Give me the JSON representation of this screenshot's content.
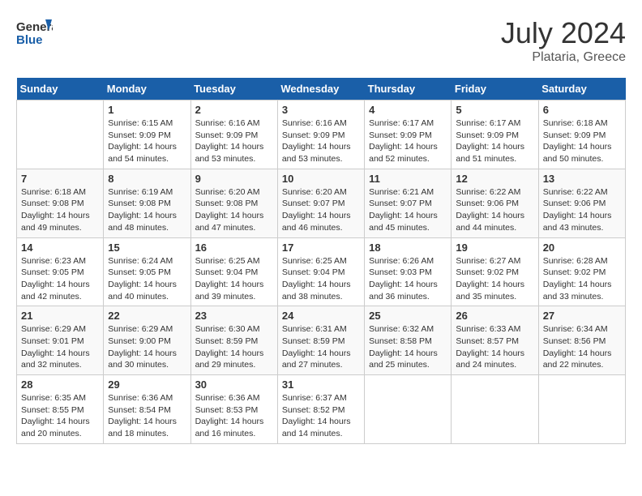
{
  "header": {
    "logo_general": "General",
    "logo_blue": "Blue",
    "month": "July 2024",
    "location": "Plataria, Greece"
  },
  "weekdays": [
    "Sunday",
    "Monday",
    "Tuesday",
    "Wednesday",
    "Thursday",
    "Friday",
    "Saturday"
  ],
  "weeks": [
    [
      {
        "day": "",
        "info": ""
      },
      {
        "day": "1",
        "info": "Sunrise: 6:15 AM\nSunset: 9:09 PM\nDaylight: 14 hours\nand 54 minutes."
      },
      {
        "day": "2",
        "info": "Sunrise: 6:16 AM\nSunset: 9:09 PM\nDaylight: 14 hours\nand 53 minutes."
      },
      {
        "day": "3",
        "info": "Sunrise: 6:16 AM\nSunset: 9:09 PM\nDaylight: 14 hours\nand 53 minutes."
      },
      {
        "day": "4",
        "info": "Sunrise: 6:17 AM\nSunset: 9:09 PM\nDaylight: 14 hours\nand 52 minutes."
      },
      {
        "day": "5",
        "info": "Sunrise: 6:17 AM\nSunset: 9:09 PM\nDaylight: 14 hours\nand 51 minutes."
      },
      {
        "day": "6",
        "info": "Sunrise: 6:18 AM\nSunset: 9:09 PM\nDaylight: 14 hours\nand 50 minutes."
      }
    ],
    [
      {
        "day": "7",
        "info": "Sunrise: 6:18 AM\nSunset: 9:08 PM\nDaylight: 14 hours\nand 49 minutes."
      },
      {
        "day": "8",
        "info": "Sunrise: 6:19 AM\nSunset: 9:08 PM\nDaylight: 14 hours\nand 48 minutes."
      },
      {
        "day": "9",
        "info": "Sunrise: 6:20 AM\nSunset: 9:08 PM\nDaylight: 14 hours\nand 47 minutes."
      },
      {
        "day": "10",
        "info": "Sunrise: 6:20 AM\nSunset: 9:07 PM\nDaylight: 14 hours\nand 46 minutes."
      },
      {
        "day": "11",
        "info": "Sunrise: 6:21 AM\nSunset: 9:07 PM\nDaylight: 14 hours\nand 45 minutes."
      },
      {
        "day": "12",
        "info": "Sunrise: 6:22 AM\nSunset: 9:06 PM\nDaylight: 14 hours\nand 44 minutes."
      },
      {
        "day": "13",
        "info": "Sunrise: 6:22 AM\nSunset: 9:06 PM\nDaylight: 14 hours\nand 43 minutes."
      }
    ],
    [
      {
        "day": "14",
        "info": "Sunrise: 6:23 AM\nSunset: 9:05 PM\nDaylight: 14 hours\nand 42 minutes."
      },
      {
        "day": "15",
        "info": "Sunrise: 6:24 AM\nSunset: 9:05 PM\nDaylight: 14 hours\nand 40 minutes."
      },
      {
        "day": "16",
        "info": "Sunrise: 6:25 AM\nSunset: 9:04 PM\nDaylight: 14 hours\nand 39 minutes."
      },
      {
        "day": "17",
        "info": "Sunrise: 6:25 AM\nSunset: 9:04 PM\nDaylight: 14 hours\nand 38 minutes."
      },
      {
        "day": "18",
        "info": "Sunrise: 6:26 AM\nSunset: 9:03 PM\nDaylight: 14 hours\nand 36 minutes."
      },
      {
        "day": "19",
        "info": "Sunrise: 6:27 AM\nSunset: 9:02 PM\nDaylight: 14 hours\nand 35 minutes."
      },
      {
        "day": "20",
        "info": "Sunrise: 6:28 AM\nSunset: 9:02 PM\nDaylight: 14 hours\nand 33 minutes."
      }
    ],
    [
      {
        "day": "21",
        "info": "Sunrise: 6:29 AM\nSunset: 9:01 PM\nDaylight: 14 hours\nand 32 minutes."
      },
      {
        "day": "22",
        "info": "Sunrise: 6:29 AM\nSunset: 9:00 PM\nDaylight: 14 hours\nand 30 minutes."
      },
      {
        "day": "23",
        "info": "Sunrise: 6:30 AM\nSunset: 8:59 PM\nDaylight: 14 hours\nand 29 minutes."
      },
      {
        "day": "24",
        "info": "Sunrise: 6:31 AM\nSunset: 8:59 PM\nDaylight: 14 hours\nand 27 minutes."
      },
      {
        "day": "25",
        "info": "Sunrise: 6:32 AM\nSunset: 8:58 PM\nDaylight: 14 hours\nand 25 minutes."
      },
      {
        "day": "26",
        "info": "Sunrise: 6:33 AM\nSunset: 8:57 PM\nDaylight: 14 hours\nand 24 minutes."
      },
      {
        "day": "27",
        "info": "Sunrise: 6:34 AM\nSunset: 8:56 PM\nDaylight: 14 hours\nand 22 minutes."
      }
    ],
    [
      {
        "day": "28",
        "info": "Sunrise: 6:35 AM\nSunset: 8:55 PM\nDaylight: 14 hours\nand 20 minutes."
      },
      {
        "day": "29",
        "info": "Sunrise: 6:36 AM\nSunset: 8:54 PM\nDaylight: 14 hours\nand 18 minutes."
      },
      {
        "day": "30",
        "info": "Sunrise: 6:36 AM\nSunset: 8:53 PM\nDaylight: 14 hours\nand 16 minutes."
      },
      {
        "day": "31",
        "info": "Sunrise: 6:37 AM\nSunset: 8:52 PM\nDaylight: 14 hours\nand 14 minutes."
      },
      {
        "day": "",
        "info": ""
      },
      {
        "day": "",
        "info": ""
      },
      {
        "day": "",
        "info": ""
      }
    ]
  ]
}
